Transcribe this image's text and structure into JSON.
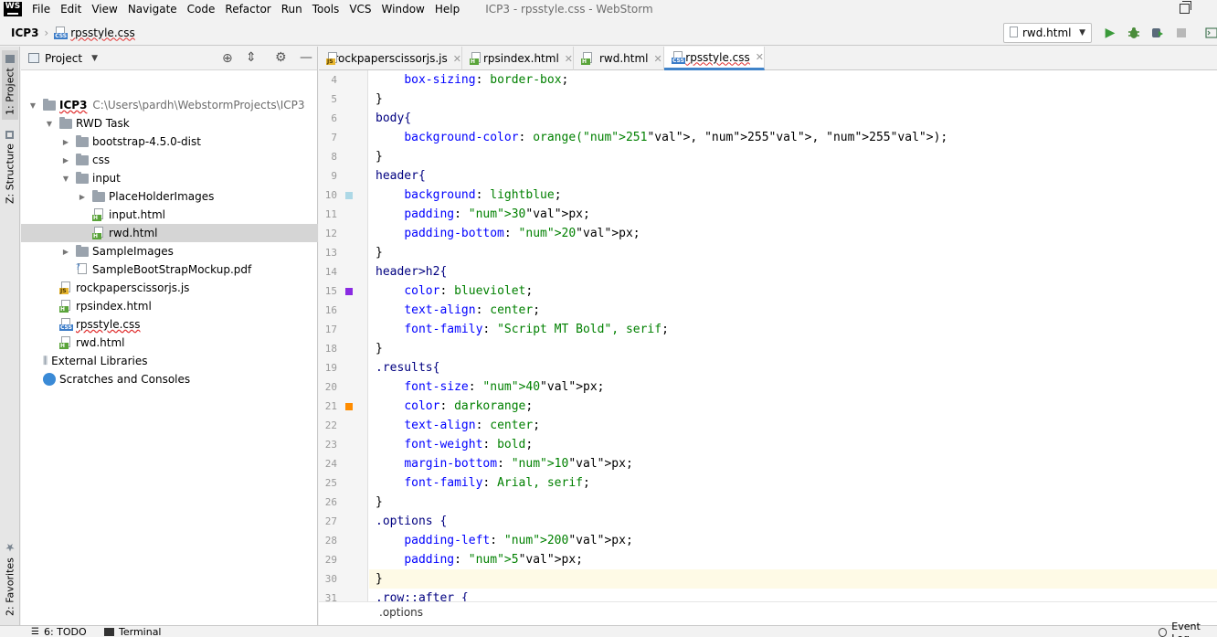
{
  "window": {
    "title": "ICP3 - rpsstyle.css - WebStorm",
    "logo": "WS"
  },
  "menu": [
    "File",
    "Edit",
    "View",
    "Navigate",
    "Code",
    "Refactor",
    "Run",
    "Tools",
    "VCS",
    "Window",
    "Help"
  ],
  "breadcrumb": {
    "project": "ICP3",
    "file": "rpsstyle.css"
  },
  "run_config": {
    "selected": "rwd.html"
  },
  "left_tabs": {
    "project": "1: Project",
    "structure": "Z: Structure",
    "favorites": "2: Favorites"
  },
  "project_panel": {
    "title": "Project"
  },
  "tree": [
    {
      "label": "ICP3",
      "path": "C:\\Users\\pardh\\WebstormProjects\\ICP3",
      "type": "project",
      "depth": 0,
      "open": true
    },
    {
      "label": "RWD Task",
      "type": "folder",
      "depth": 1,
      "open": true
    },
    {
      "label": "bootstrap-4.5.0-dist",
      "type": "folder",
      "depth": 2,
      "open": false
    },
    {
      "label": "css",
      "type": "folder",
      "depth": 2,
      "open": false
    },
    {
      "label": "input",
      "type": "folder",
      "depth": 2,
      "open": true
    },
    {
      "label": "PlaceHolderImages",
      "type": "folder",
      "depth": 3,
      "open": false
    },
    {
      "label": "input.html",
      "type": "html",
      "depth": 3
    },
    {
      "label": "rwd.html",
      "type": "html",
      "depth": 3,
      "selected": true
    },
    {
      "label": "SampleImages",
      "type": "folder",
      "depth": 2,
      "open": false
    },
    {
      "label": "SampleBootStrapMockup.pdf",
      "type": "pdf",
      "depth": 2
    },
    {
      "label": "rockpaperscissorjs.js",
      "type": "js",
      "depth": 1
    },
    {
      "label": "rpsindex.html",
      "type": "html",
      "depth": 1
    },
    {
      "label": "rpsstyle.css",
      "type": "css",
      "depth": 1
    },
    {
      "label": "rwd.html",
      "type": "html",
      "depth": 1
    },
    {
      "label": "External Libraries",
      "type": "lib",
      "depth": 0
    },
    {
      "label": "Scratches and Consoles",
      "type": "scratch",
      "depth": 0
    }
  ],
  "tabs": [
    {
      "label": "rockpaperscissorjs.js",
      "type": "js"
    },
    {
      "label": "rpsindex.html",
      "type": "html"
    },
    {
      "label": "rwd.html",
      "type": "html"
    },
    {
      "label": "rpsstyle.css",
      "type": "css",
      "active": true
    }
  ],
  "code": [
    {
      "n": "4",
      "text": "    box-sizing: border-box;"
    },
    {
      "n": "5",
      "text": "}"
    },
    {
      "n": "6",
      "text": "body{"
    },
    {
      "n": "7",
      "text": "    background-color: orange(251, 255, 255);"
    },
    {
      "n": "8",
      "text": "}"
    },
    {
      "n": "9",
      "text": "header{"
    },
    {
      "n": "10",
      "text": "    background: lightblue;",
      "swatch": "#add8e6"
    },
    {
      "n": "11",
      "text": "    padding: 30px;"
    },
    {
      "n": "12",
      "text": "    padding-bottom: 20px;"
    },
    {
      "n": "13",
      "text": "}"
    },
    {
      "n": "14",
      "text": "header>h2{"
    },
    {
      "n": "15",
      "text": "    color: blueviolet;",
      "swatch": "#8a2be2"
    },
    {
      "n": "16",
      "text": "    text-align: center;"
    },
    {
      "n": "17",
      "text": "    font-family: \"Script MT Bold\", serif;"
    },
    {
      "n": "18",
      "text": "}"
    },
    {
      "n": "19",
      "text": ".results{"
    },
    {
      "n": "20",
      "text": "    font-size: 40px;"
    },
    {
      "n": "21",
      "text": "    color: darkorange;",
      "swatch": "#ff8c00"
    },
    {
      "n": "22",
      "text": "    text-align: center;"
    },
    {
      "n": "23",
      "text": "    font-weight: bold;"
    },
    {
      "n": "24",
      "text": "    margin-bottom: 10px;"
    },
    {
      "n": "25",
      "text": "    font-family: Arial, serif;"
    },
    {
      "n": "26",
      "text": "}"
    },
    {
      "n": "27",
      "text": ".options {"
    },
    {
      "n": "28",
      "text": "    padding-left: 200px;"
    },
    {
      "n": "29",
      "text": "    padding: 5px;"
    },
    {
      "n": "30",
      "text": "}"
    },
    {
      "n": "31",
      "text": ".row::after {"
    }
  ],
  "editor_breadcrumb": ".options",
  "status": {
    "todo": "6: TODO",
    "terminal": "Terminal",
    "event_log": "Event Log"
  },
  "colors": {
    "accent": "#4083c9",
    "selection": "#d5d5d5",
    "current_line": "#fefae6"
  }
}
